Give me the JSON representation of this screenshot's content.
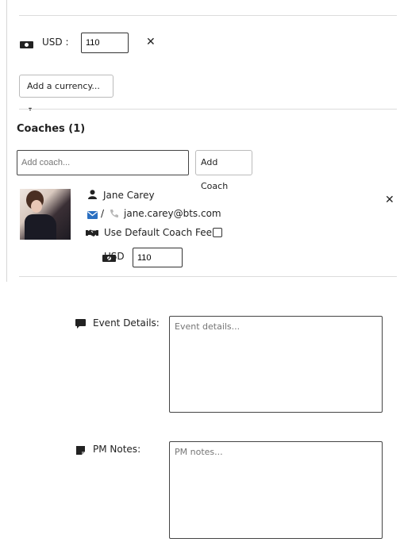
{
  "currency_row": {
    "currency_label": "USD :",
    "amount_value": "110"
  },
  "add_currency": {
    "label": "Add a currency...",
    "caret": "▾"
  },
  "coaches": {
    "title": "Coaches (1)",
    "add_placeholder": "Add coach...",
    "add_button": "Add Coach",
    "coach": {
      "name": "Jane Carey",
      "contact_separator": "/",
      "email": "jane.carey@bts.com",
      "default_fee_label": "Use Default Coach Fee",
      "currency_label": "USD",
      "fee_value": "110"
    }
  },
  "event_details": {
    "label": "Event Details:",
    "placeholder": "Event details..."
  },
  "pm_notes": {
    "label": "PM Notes:",
    "placeholder": "PM notes..."
  },
  "remove_symbol": "✕",
  "colors": {
    "link": "#2a6fc1",
    "border": "#333333"
  }
}
